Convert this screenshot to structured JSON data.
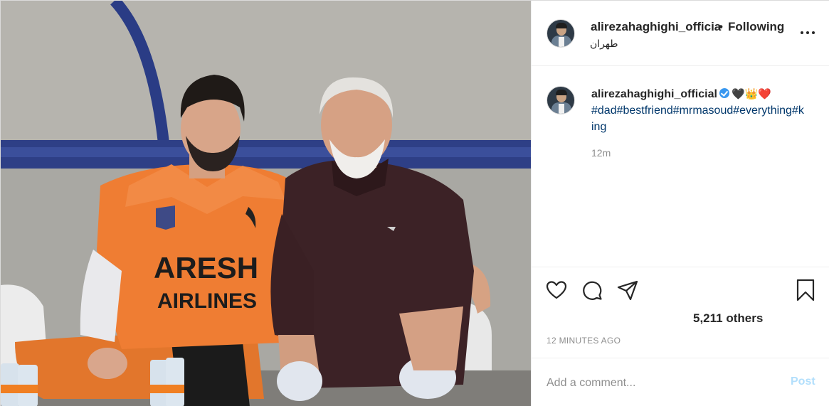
{
  "post": {
    "header": {
      "username": "alirezahaghighi_officia",
      "separator": "•",
      "follow_state": "Following",
      "location": "طهران",
      "more_icon": "more-horizontal-icon"
    },
    "photo": {
      "jersey_text_line1": "ARESH",
      "jersey_text_line2": "AIRLINES"
    },
    "caption": {
      "username": "alirezahaghighi_official",
      "verified_icon": "verified-badge-icon",
      "emojis": "🖤👑❤️",
      "hashtags": "#dad#bestfriend#mrmasoud#everything#king",
      "time": "12m"
    },
    "actions": {
      "like_icon": "heart-icon",
      "comment_icon": "comment-icon",
      "share_icon": "send-icon",
      "save_icon": "bookmark-icon",
      "likes": "5,211 others",
      "timestamp": "12 MINUTES AGO"
    },
    "comment_box": {
      "placeholder": "Add a comment...",
      "post_label": "Post"
    },
    "colors": {
      "link": "#00376b",
      "verified": "#3897f0",
      "muted": "#8e8e8e",
      "post_button_disabled": "#b2dffc"
    }
  }
}
